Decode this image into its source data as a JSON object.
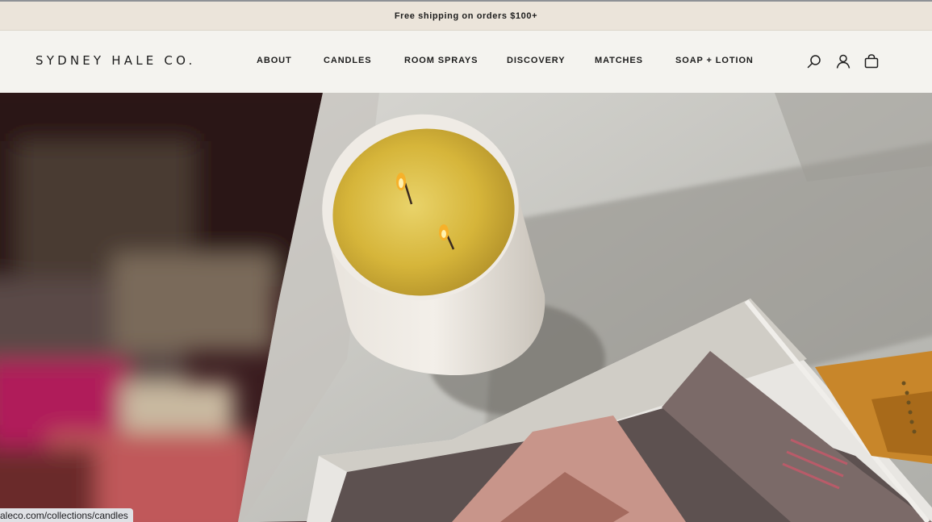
{
  "announcement": {
    "text": "Free shipping on orders $100+"
  },
  "header": {
    "logo": "SYDNEY HALE CO.",
    "nav": [
      {
        "label": "ABOUT"
      },
      {
        "label": "CANDLES"
      },
      {
        "label": "ROOM SPRAYS"
      },
      {
        "label": "DISCOVERY"
      },
      {
        "label": "MATCHES"
      },
      {
        "label": "SOAP + LOTION"
      }
    ],
    "icons": [
      "search-icon",
      "account-icon",
      "cart-icon"
    ]
  },
  "hero": {
    "image": "lit-two-wick-candle-on-marble-tray-with-magazine"
  },
  "status_bar": {
    "url": "aleco.com/collections/candles"
  },
  "colors": {
    "announcement_bg": "#ebe4da",
    "header_bg": "#f4f3ef",
    "text": "#1c1c1c"
  }
}
